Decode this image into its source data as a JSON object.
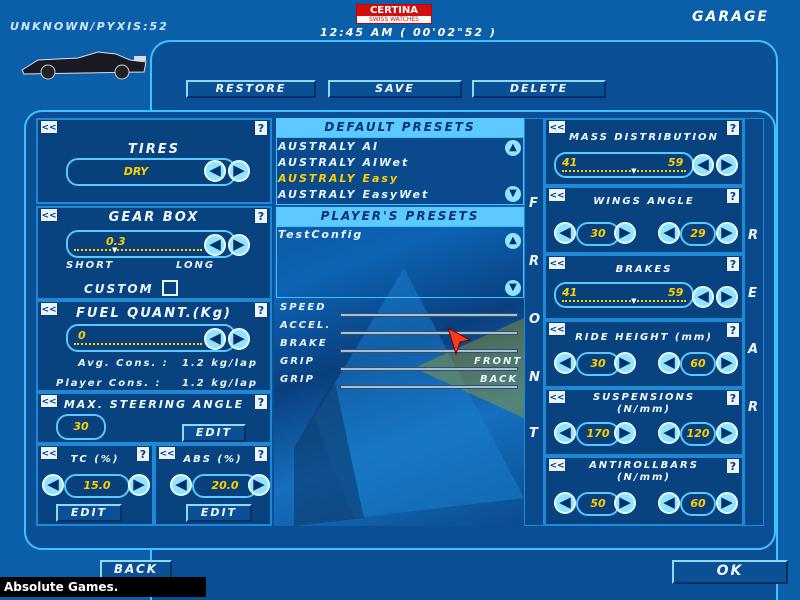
{
  "header": {
    "profile": "UNKNOWN/PYXIS:52",
    "time": "12:45 AM ( 00'02\"52 )",
    "logo_top": "CERTINA",
    "logo_bottom": "SWISS WATCHES",
    "screen_title": "GARAGE"
  },
  "toolbar": {
    "restore": "RESTORE",
    "save": "SAVE",
    "delete": "DELETE"
  },
  "tires": {
    "title": "TIRES",
    "value": "DRY"
  },
  "gearbox": {
    "title": "GEAR BOX",
    "value": "0.3",
    "short": "SHORT",
    "long": "LONG",
    "level": 0.3,
    "custom": "CUSTOM"
  },
  "fuel": {
    "title": "FUEL QUANT.(Kg)",
    "value": "0",
    "avg_label": "Avg. Cons. :",
    "avg_value": "1.2 kg/lap",
    "player_label": "Player Cons. :",
    "player_value": "1.2 kg/lap"
  },
  "steering": {
    "title": "MAX. STEERING ANGLE",
    "value": "30",
    "edit": "EDIT"
  },
  "tc": {
    "title": "TC (%)",
    "value": "15.0",
    "edit": "EDIT"
  },
  "abs": {
    "title": "ABS (%)",
    "value": "20.0",
    "edit": "EDIT"
  },
  "default_presets": {
    "title": "DEFAULT PRESETS",
    "items": [
      "AUSTRALY AI",
      "AUSTRALY AIWet",
      "AUSTRALY Easy",
      "AUSTRALY EasyWet"
    ],
    "selected_index": 2
  },
  "player_presets": {
    "title": "PLAYER'S PRESETS",
    "items": [
      "TestConfig"
    ]
  },
  "stats": {
    "speed": "SPEED",
    "accel": "ACCEL.",
    "brake": "BRAKE",
    "grip": "GRIP",
    "front": "FRONT",
    "back": "BACK"
  },
  "front_label": [
    "F",
    "R",
    "O",
    "N",
    "T"
  ],
  "rear_label": [
    "R",
    "E",
    "A",
    "R"
  ],
  "mass": {
    "title": "MASS DISTRIBUTION",
    "left": "41",
    "right": "59",
    "level": 0.59
  },
  "wings": {
    "title": "WINGS ANGLE",
    "front": "30",
    "rear": "29"
  },
  "brakes": {
    "title": "BRAKES",
    "left": "41",
    "right": "59",
    "level": 0.59
  },
  "ride": {
    "title": "RIDE HEIGHT (mm)",
    "front": "30",
    "rear": "60"
  },
  "susp": {
    "title_1": "SUSPENSIONS",
    "title_2": "(N/mm)",
    "front": "170",
    "rear": "120"
  },
  "arb": {
    "title_1": "ANTIROLLBARS",
    "title_2": "(N/mm)",
    "front": "50",
    "rear": "60"
  },
  "footer": {
    "back": "BACK",
    "ok": "OK",
    "watermark": "Absolute Games. WWW.AG.RU"
  },
  "icons": {
    "left": "◀",
    "right": "▶",
    "up": "▲",
    "down": "▼",
    "collapse": "<<",
    "help": "?"
  },
  "colors": {
    "accent": "#3fc0ff",
    "value": "#ffd000",
    "bg": "#0b5ea8"
  }
}
